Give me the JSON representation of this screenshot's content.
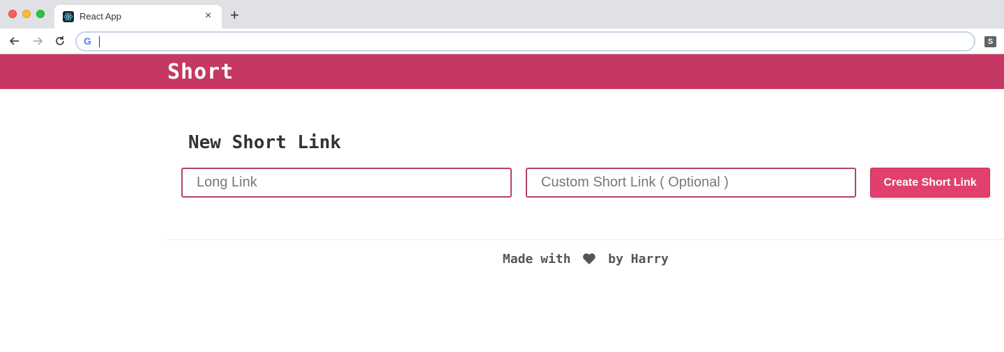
{
  "browser": {
    "tab_title": "React App",
    "tab_close": "×",
    "new_tab": "+",
    "omnibox_icon": "G",
    "omnibox_value": "",
    "extension_label": "S"
  },
  "header": {
    "brand": "Short",
    "brand_color": "#c43863"
  },
  "main": {
    "title": "New Short Link",
    "long_link_placeholder": "Long Link",
    "custom_link_placeholder": "Custom Short Link ( Optional )",
    "create_button_label": "Create Short Link",
    "accent_color": "#e13f6d"
  },
  "footer": {
    "prefix": "Made with",
    "icon": "heart-icon",
    "suffix": "by Harry"
  }
}
